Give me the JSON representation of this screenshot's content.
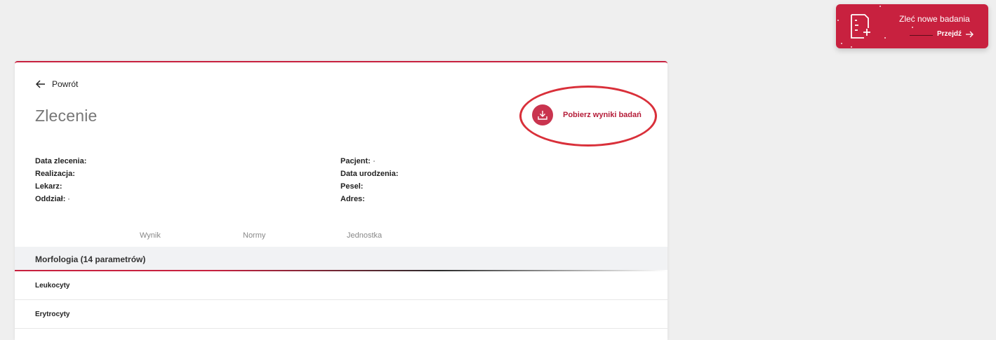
{
  "promo": {
    "title": "Zleć nowe badania",
    "link_label": "Przejdź",
    "icon": "document-plus-icon",
    "color": "#c8213f"
  },
  "card": {
    "back_label": "Powrót",
    "title": "Zlecenie",
    "download_label": "Pobierz wyniki badań",
    "download_icon": "download-icon",
    "accent": "#c8213f"
  },
  "info": {
    "left": [
      {
        "label": "Data zlecenia:"
      },
      {
        "label": "Realizacja:"
      },
      {
        "label": "Lekarz:"
      },
      {
        "label": "Oddział:"
      }
    ],
    "right": [
      {
        "label": "Pacjent:"
      },
      {
        "label": "Data urodzenia:"
      },
      {
        "label": "Pesel:"
      },
      {
        "label": "Adres:"
      }
    ]
  },
  "results_table": {
    "columns": [
      "Wynik",
      "Normy",
      "Jednostka"
    ],
    "group": "Morfologia (14 parametrów)",
    "rows": [
      "Leukocyty",
      "Erytrocyty"
    ]
  }
}
